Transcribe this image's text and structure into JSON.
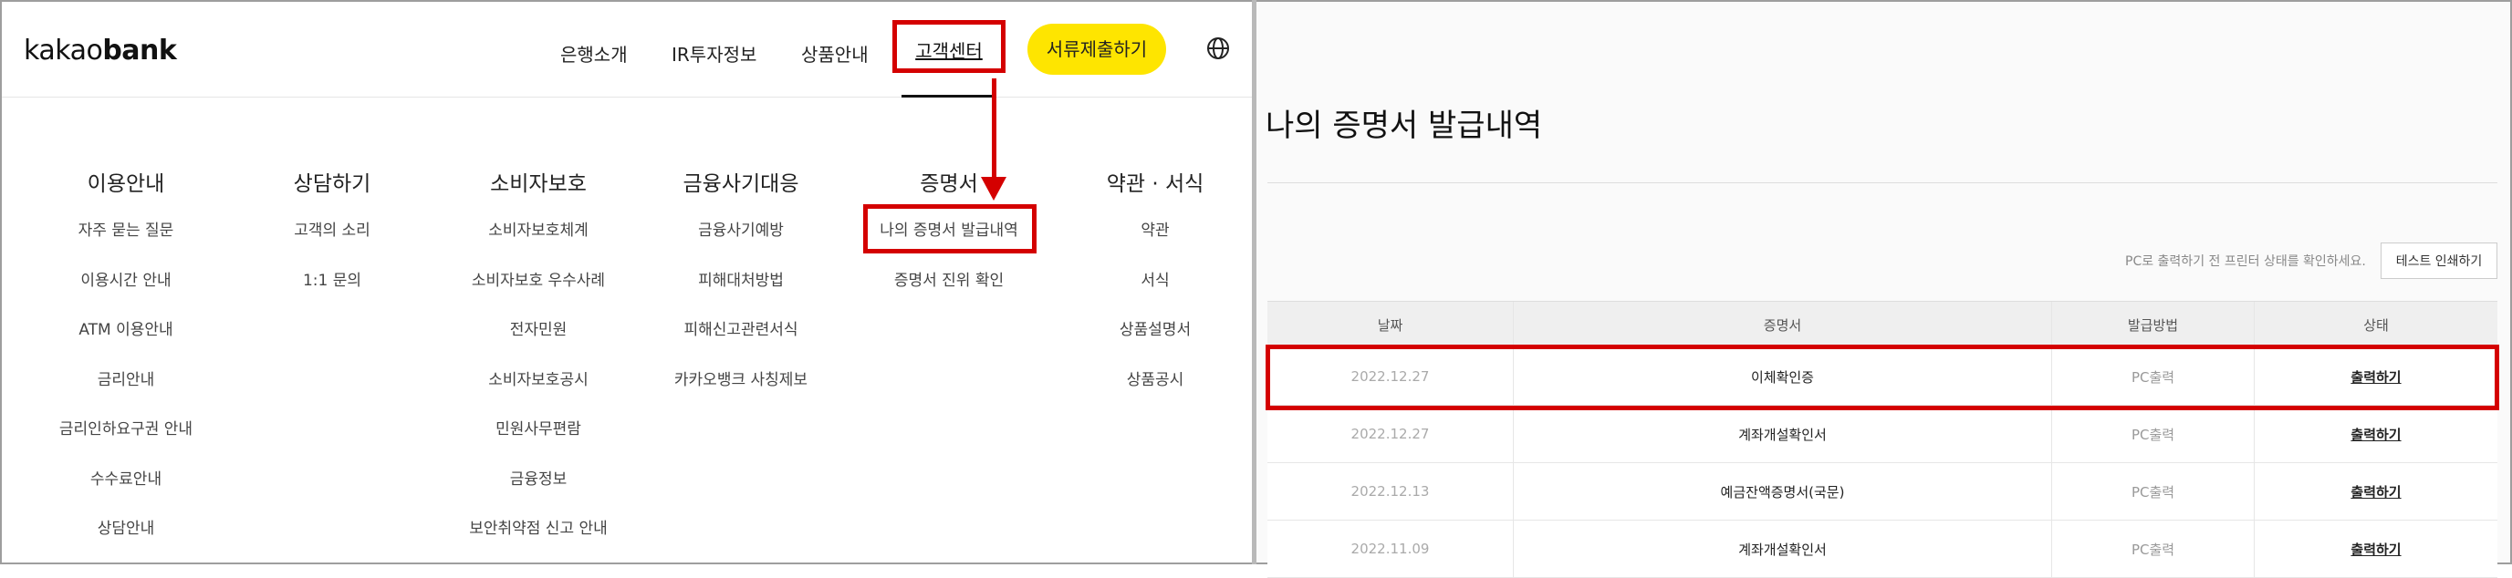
{
  "header": {
    "logo_light": "kakao",
    "logo_bold": "bank",
    "nav": [
      "은행소개",
      "IR투자정보",
      "상품안내"
    ],
    "nav_active": "고객센터",
    "submit_label": "서류제출하기",
    "globe_icon": "globe-icon"
  },
  "menu": {
    "columns": [
      {
        "title": "이용안내",
        "items": [
          "자주 묻는 질문",
          "이용시간 안내",
          "ATM 이용안내",
          "금리안내",
          "금리인하요구권 안내",
          "수수료안내",
          "상담안내"
        ]
      },
      {
        "title": "상담하기",
        "items": [
          "고객의 소리",
          "1:1 문의"
        ]
      },
      {
        "title": "소비자보호",
        "items": [
          "소비자보호체계",
          "소비자보호 우수사례",
          "전자민원",
          "소비자보호공시",
          "민원사무편람",
          "금융정보",
          "보안취약점 신고 안내"
        ]
      },
      {
        "title": "금융사기대응",
        "items": [
          "금융사기예방",
          "피해대처방법",
          "피해신고관련서식",
          "카카오뱅크 사칭제보"
        ]
      },
      {
        "title": "증명서",
        "items": [
          "나의 증명서 발급내역",
          "증명서 진위 확인"
        ]
      },
      {
        "title": "약관 · 서식",
        "items": [
          "약관",
          "서식",
          "상품설명서",
          "상품공시"
        ]
      }
    ]
  },
  "right": {
    "title": "나의 증명서 발급내역",
    "print_hint": "PC로 출력하기 전 프린터 상태를 확인하세요.",
    "test_print_label": "테스트 인쇄하기",
    "table": {
      "headers": [
        "날짜",
        "증명서",
        "발급방법",
        "상태"
      ],
      "rows": [
        {
          "date": "2022.12.27",
          "cert": "이체확인증",
          "method": "PC출력",
          "status": "출력하기"
        },
        {
          "date": "2022.12.27",
          "cert": "계좌개설확인서",
          "method": "PC출력",
          "status": "출력하기"
        },
        {
          "date": "2022.12.13",
          "cert": "예금잔액증명서(국문)",
          "method": "PC출력",
          "status": "출력하기"
        },
        {
          "date": "2022.11.09",
          "cert": "계좌개설확인서",
          "method": "PC출력",
          "status": "출력하기"
        }
      ]
    }
  },
  "colors": {
    "accent": "#fee500",
    "highlight": "#d40000"
  }
}
